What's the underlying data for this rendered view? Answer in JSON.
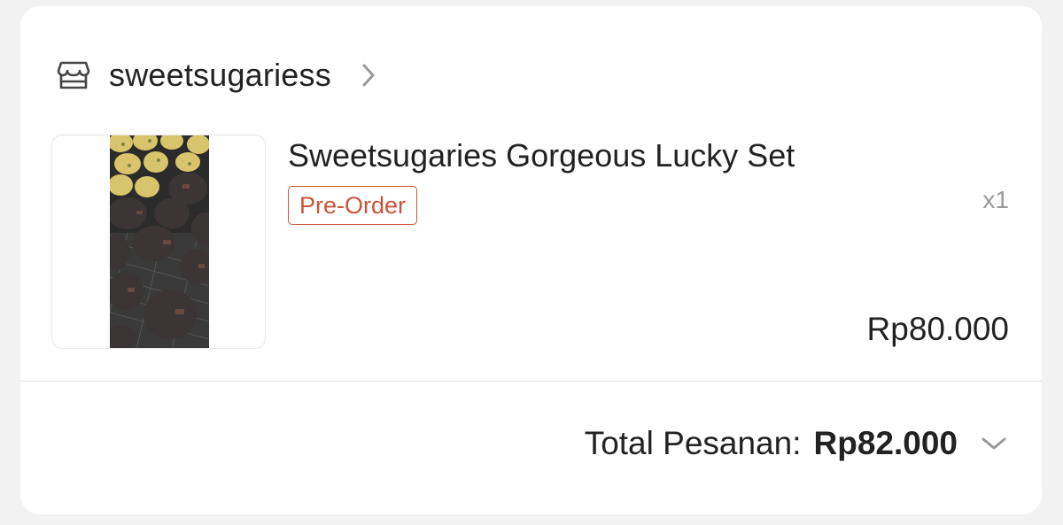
{
  "shop": {
    "name": "sweetsugariess",
    "icon": "store-icon",
    "chevron_icon": "chevron-right-icon"
  },
  "product": {
    "title": "Sweetsugaries Gorgeous Lucky Set",
    "badge": "Pre-Order",
    "quantity": "x1",
    "price": "Rp80.000",
    "image": "product-thumbnail-cookies"
  },
  "order_total": {
    "label": "Total Pesanan:",
    "value": "Rp82.000",
    "expand_icon": "chevron-down-icon"
  },
  "colors": {
    "badge": "#c8553a",
    "text": "#222222",
    "muted": "#9a9a9a",
    "background": "#f2f2f2",
    "card": "#ffffff"
  }
}
